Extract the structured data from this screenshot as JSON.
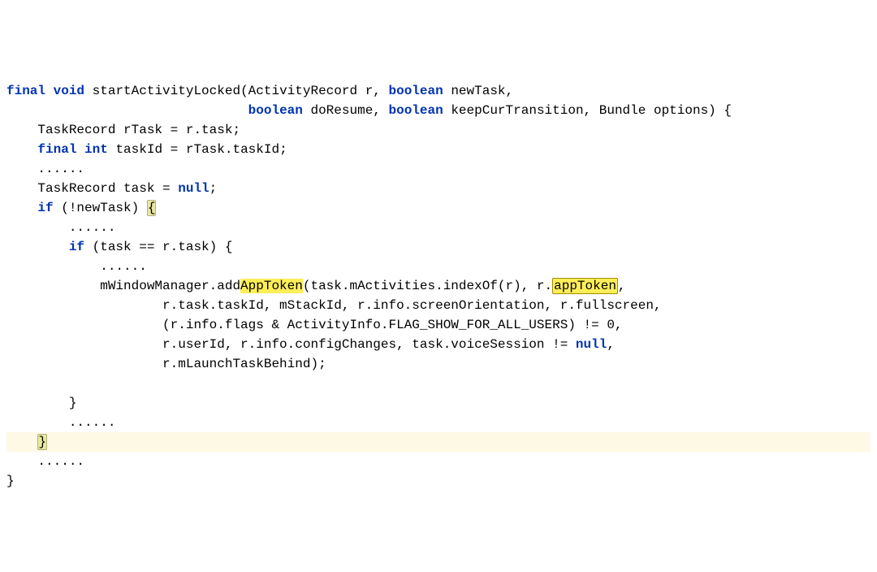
{
  "code": {
    "l1a": "final",
    "l1b": "void",
    "l1c": " startActivityLocked(ActivityRecord r, ",
    "l1d": "boolean",
    "l1e": " newTask,",
    "l2a": "                               ",
    "l2b": "boolean",
    "l2c": " doResume, ",
    "l2d": "boolean",
    "l2e": " keepCurTransition, Bundle options) {",
    "l3a": "    TaskRecord rTask = r.task;",
    "l4a": "    ",
    "l4b": "final",
    "l4c": " ",
    "l4d": "int",
    "l4e": " taskId = rTask.taskId;",
    "l5a": "    ......",
    "l6a": "    TaskRecord task = ",
    "l6b": "null",
    "l6c": ";",
    "l7a": "    ",
    "l7b": "if",
    "l7c": " (!newTask) ",
    "l7d": "{",
    "l8a": "        ......",
    "l9a": "        ",
    "l9b": "if",
    "l9c": " (task == r.task) {",
    "l10a": "            ......",
    "l11a": "            mWindowManager.add",
    "l11b": "AppToken",
    "l11c": "(task.mActivities.indexOf(r), r.",
    "l11d": "appToken",
    "l11e": ",",
    "l12a": "                    r.task.taskId, mStackId, r.info.screenOrientation, r.fullscreen,",
    "l13a": "                    (r.info.flags & ActivityInfo.FLAG_SHOW_FOR_ALL_USERS) != 0,",
    "l14a": "                    r.userId, r.info.configChanges, task.voiceSession != ",
    "l14b": "null",
    "l14c": ",",
    "l15a": "                    r.mLaunchTaskBehind);",
    "l16a": "",
    "l17a": "        }",
    "l18a": "        ......",
    "l19a": "    ",
    "l19b": "}",
    "l20a": "    ......",
    "l21a": "}"
  }
}
